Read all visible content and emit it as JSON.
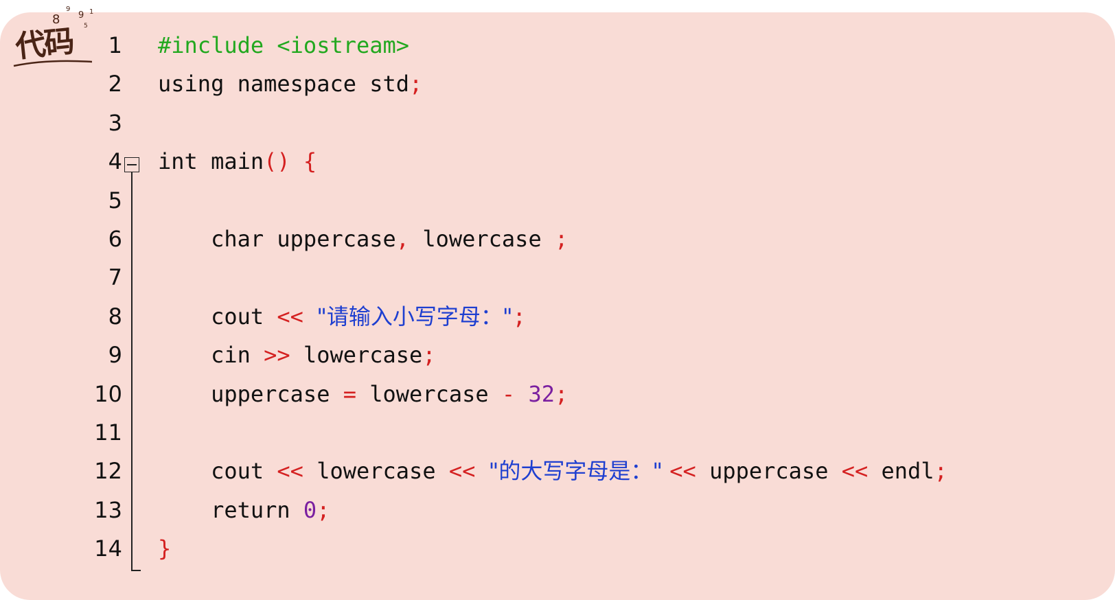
{
  "badge": {
    "label": "代码",
    "digits": "8 9 1 9 5"
  },
  "lines": [
    {
      "n": "1",
      "tokens": [
        {
          "t": "#include <iostream>",
          "c": "pp"
        }
      ]
    },
    {
      "n": "2",
      "tokens": [
        {
          "t": "using namespace std",
          "c": "plain"
        },
        {
          "t": ";",
          "c": "op"
        }
      ]
    },
    {
      "n": "3",
      "tokens": []
    },
    {
      "n": "4",
      "tokens": [
        {
          "t": "int main",
          "c": "plain"
        },
        {
          "t": "() {",
          "c": "op"
        }
      ]
    },
    {
      "n": "5",
      "tokens": []
    },
    {
      "n": "6",
      "tokens": [
        {
          "t": "    char uppercase",
          "c": "plain"
        },
        {
          "t": ", ",
          "c": "op"
        },
        {
          "t": "lowercase ",
          "c": "plain"
        },
        {
          "t": ";",
          "c": "op"
        }
      ]
    },
    {
      "n": "7",
      "tokens": []
    },
    {
      "n": "8",
      "tokens": [
        {
          "t": "    cout ",
          "c": "plain"
        },
        {
          "t": "<< ",
          "c": "op"
        },
        {
          "t": "\"请输入小写字母：\"",
          "c": "str"
        },
        {
          "t": ";",
          "c": "op"
        }
      ]
    },
    {
      "n": "9",
      "tokens": [
        {
          "t": "    cin ",
          "c": "plain"
        },
        {
          "t": ">> ",
          "c": "op"
        },
        {
          "t": "lowercase",
          "c": "plain"
        },
        {
          "t": ";",
          "c": "op"
        }
      ]
    },
    {
      "n": "10",
      "tokens": [
        {
          "t": "    uppercase ",
          "c": "plain"
        },
        {
          "t": "= ",
          "c": "op"
        },
        {
          "t": "lowercase ",
          "c": "plain"
        },
        {
          "t": "- ",
          "c": "op"
        },
        {
          "t": "32",
          "c": "num"
        },
        {
          "t": ";",
          "c": "op"
        }
      ]
    },
    {
      "n": "11",
      "tokens": []
    },
    {
      "n": "12",
      "tokens": [
        {
          "t": "    cout ",
          "c": "plain"
        },
        {
          "t": "<< ",
          "c": "op"
        },
        {
          "t": "lowercase ",
          "c": "plain"
        },
        {
          "t": "<< ",
          "c": "op"
        },
        {
          "t": "\"的大写字母是：\" ",
          "c": "str"
        },
        {
          "t": "<< ",
          "c": "op"
        },
        {
          "t": "uppercase ",
          "c": "plain"
        },
        {
          "t": "<< ",
          "c": "op"
        },
        {
          "t": "endl",
          "c": "plain"
        },
        {
          "t": ";",
          "c": "op"
        }
      ]
    },
    {
      "n": "13",
      "tokens": [
        {
          "t": "    return ",
          "c": "plain"
        },
        {
          "t": "0",
          "c": "num"
        },
        {
          "t": ";",
          "c": "op"
        }
      ]
    },
    {
      "n": "14",
      "tokens": [
        {
          "t": "}",
          "c": "op"
        }
      ]
    }
  ]
}
